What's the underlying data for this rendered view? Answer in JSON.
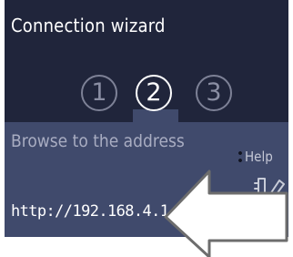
{
  "wizard": {
    "title": "Connection wizard",
    "steps": [
      {
        "label": "1",
        "state": "inactive"
      },
      {
        "label": "2",
        "state": "active"
      },
      {
        "label": "3",
        "state": "inactive"
      }
    ],
    "instruction": "Browse to the address",
    "help_label": "Help",
    "url": "http://192.168.4.1"
  },
  "icons": {
    "help": "dots-icon",
    "edit": "edit-pencil-icon",
    "pointer": "arrow-pointer-icon"
  },
  "colors": {
    "header_bg": "#20253b",
    "panel_bg": "#404a6c",
    "text_primary": "#ffffff",
    "text_muted": "#a9adc2",
    "step_inactive": "#7d8196"
  }
}
